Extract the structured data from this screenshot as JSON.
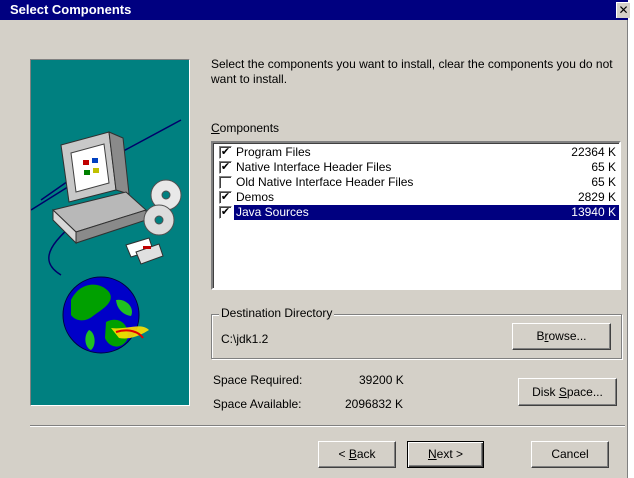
{
  "window": {
    "title": "Select Components",
    "close_glyph": "✕"
  },
  "instructions": "Select the components you want to install, clear the components you do not want to install.",
  "components": {
    "label_prefix": "",
    "label_hotkey": "C",
    "label_rest": "omponents",
    "items": [
      {
        "name": "Program Files",
        "size": "22364 K",
        "checked": true,
        "selected": false
      },
      {
        "name": "Native Interface Header Files",
        "size": "65 K",
        "checked": true,
        "selected": false
      },
      {
        "name": "Old Native Interface Header Files",
        "size": "65 K",
        "checked": false,
        "selected": false
      },
      {
        "name": "Demos",
        "size": "2829 K",
        "checked": true,
        "selected": false
      },
      {
        "name": "Java Sources",
        "size": "13940 K",
        "checked": true,
        "selected": true
      }
    ]
  },
  "destination": {
    "title": "Destination Directory",
    "path": "C:\\jdk1.2",
    "browse": {
      "pre": "B",
      "hotkey": "r",
      "post": "owse..."
    }
  },
  "space": {
    "required_label": "Space Required:",
    "required_value": "39200 K",
    "available_label": "Space Available:",
    "available_value": "2096832 K",
    "disk_space": {
      "pre": "Disk ",
      "hotkey": "S",
      "post": "pace..."
    }
  },
  "buttons": {
    "back": {
      "pre": "< ",
      "hotkey": "B",
      "post": "ack"
    },
    "next": {
      "pre": "",
      "hotkey": "N",
      "post": "ext >"
    },
    "cancel": "Cancel"
  },
  "icons": {
    "art": "computer-cd-globe-illustration",
    "check": "✔",
    "close": "close-icon"
  },
  "colors": {
    "title_bar": "#000080",
    "art_background": "#008080",
    "dialog": "#d4d0c8",
    "selection": "#000080"
  }
}
